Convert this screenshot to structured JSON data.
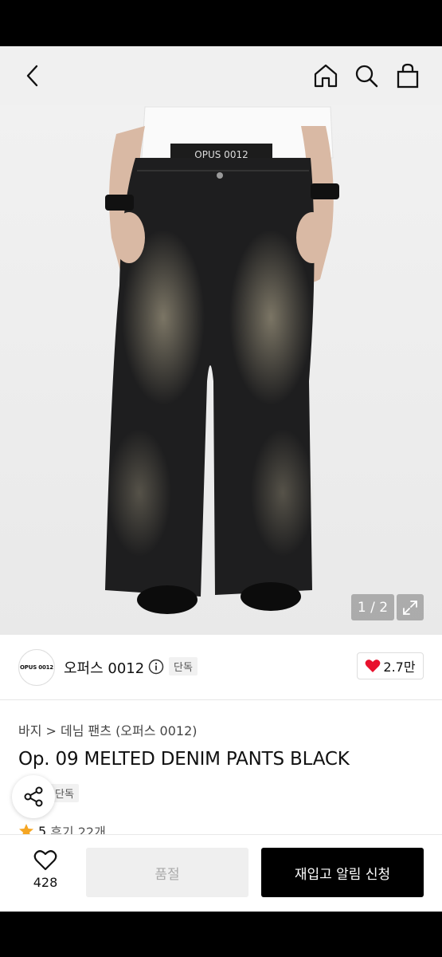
{
  "top_nav": {
    "back_icon": "chevron-left-icon",
    "home_icon": "home-icon",
    "search_icon": "search-icon",
    "bag_icon": "shopping-bag-icon"
  },
  "gallery": {
    "counter": "1 / 2",
    "waistband_text": "OPUS 0012"
  },
  "brand": {
    "logo_text": "OPUS 0012",
    "name": "오퍼스 0012",
    "badge": "단독",
    "likes": "2.7만"
  },
  "breadcrumb": "바지 > 데님 팬츠 (오퍼스 0012)",
  "product": {
    "title": "Op. 09 MELTED DENIM PANTS BLACK",
    "exclusive_badge": "단독",
    "rating": "5",
    "reviews": "후기 22개"
  },
  "bottom_bar": {
    "wish_count": "428",
    "soldout_label": "품절",
    "restock_label": "재입고 알림 신청"
  },
  "colors": {
    "like_heart": "#e8112d",
    "star": "#f5a623",
    "primary_button": "#000000"
  }
}
